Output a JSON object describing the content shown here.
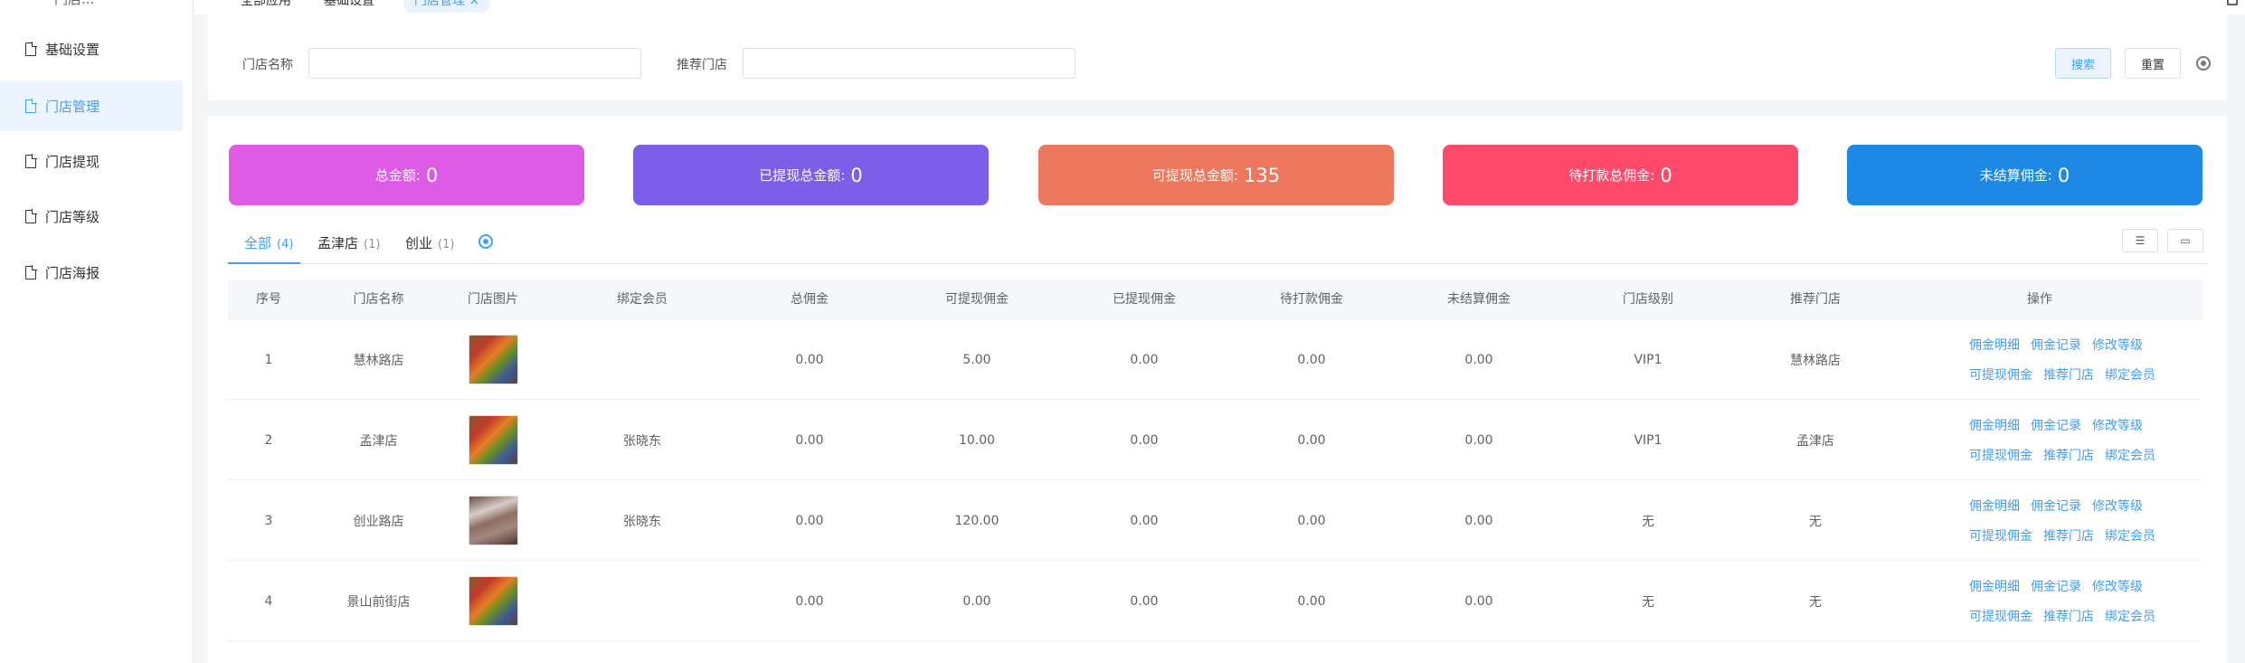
{
  "sidebar": {
    "top_label": "门店...",
    "items": [
      {
        "label": "基础设置",
        "active": false
      },
      {
        "label": "门店管理",
        "active": true
      },
      {
        "label": "门店提现",
        "active": false
      },
      {
        "label": "门店等级",
        "active": false
      },
      {
        "label": "门店海报",
        "active": false
      }
    ]
  },
  "top_tabs": [
    {
      "label": "全部应用"
    },
    {
      "label": "基础设置"
    },
    {
      "label": "门店管理 ×",
      "active": true
    }
  ],
  "search": {
    "store_name_label": "门店名称",
    "store_name_value": "",
    "recommend_label": "推荐门店",
    "recommend_value": "",
    "search_button": "搜索",
    "reset_button": "重置"
  },
  "stats": [
    {
      "label": "总金额:",
      "value": "0",
      "color": "#e05ae8"
    },
    {
      "label": "已提现总金额:",
      "value": "0",
      "color": "#7b5fe8"
    },
    {
      "label": "可提现总金额:",
      "value": "135",
      "color": "#ed785d"
    },
    {
      "label": "待打款总佣金:",
      "value": "0",
      "color": "#ff4a6b"
    },
    {
      "label": "未结算佣金:",
      "value": "0",
      "color": "#1e88e5"
    }
  ],
  "list_tabs": [
    {
      "label": "全部",
      "count": "(4)",
      "active": true
    },
    {
      "label": "孟津店",
      "count": "(1)",
      "active": false
    },
    {
      "label": "创业",
      "count": "(1)",
      "active": false
    }
  ],
  "table": {
    "headers": [
      "序号",
      "门店名称",
      "门店图片",
      "绑定会员",
      "总佣金",
      "可提现佣金",
      "已提现佣金",
      "待打款佣金",
      "未结算佣金",
      "门店级别",
      "推荐门店",
      "操作"
    ],
    "rows": [
      {
        "no": "1",
        "name": "慧林路店",
        "member": "",
        "total": "0.00",
        "withdrawable": "5.00",
        "withdrawn": "0.00",
        "pending": "0.00",
        "unsettled": "0.00",
        "level": "VIP1",
        "recommend": "慧林路店"
      },
      {
        "no": "2",
        "name": "孟津店",
        "member": "张晓东",
        "total": "0.00",
        "withdrawable": "10.00",
        "withdrawn": "0.00",
        "pending": "0.00",
        "unsettled": "0.00",
        "level": "VIP1",
        "recommend": "孟津店"
      },
      {
        "no": "3",
        "name": "创业路店",
        "member": "张晓东",
        "total": "0.00",
        "withdrawable": "120.00",
        "withdrawn": "0.00",
        "pending": "0.00",
        "unsettled": "0.00",
        "level": "无",
        "recommend": "无"
      },
      {
        "no": "4",
        "name": "景山前街店",
        "member": "",
        "total": "0.00",
        "withdrawable": "0.00",
        "withdrawn": "0.00",
        "pending": "0.00",
        "unsettled": "0.00",
        "level": "无",
        "recommend": "无"
      }
    ],
    "ops_line1": [
      "佣金明细",
      "佣金记录",
      "修改等级"
    ],
    "ops_line2": [
      "可提现佣金",
      "推荐门店",
      "绑定会员"
    ]
  }
}
